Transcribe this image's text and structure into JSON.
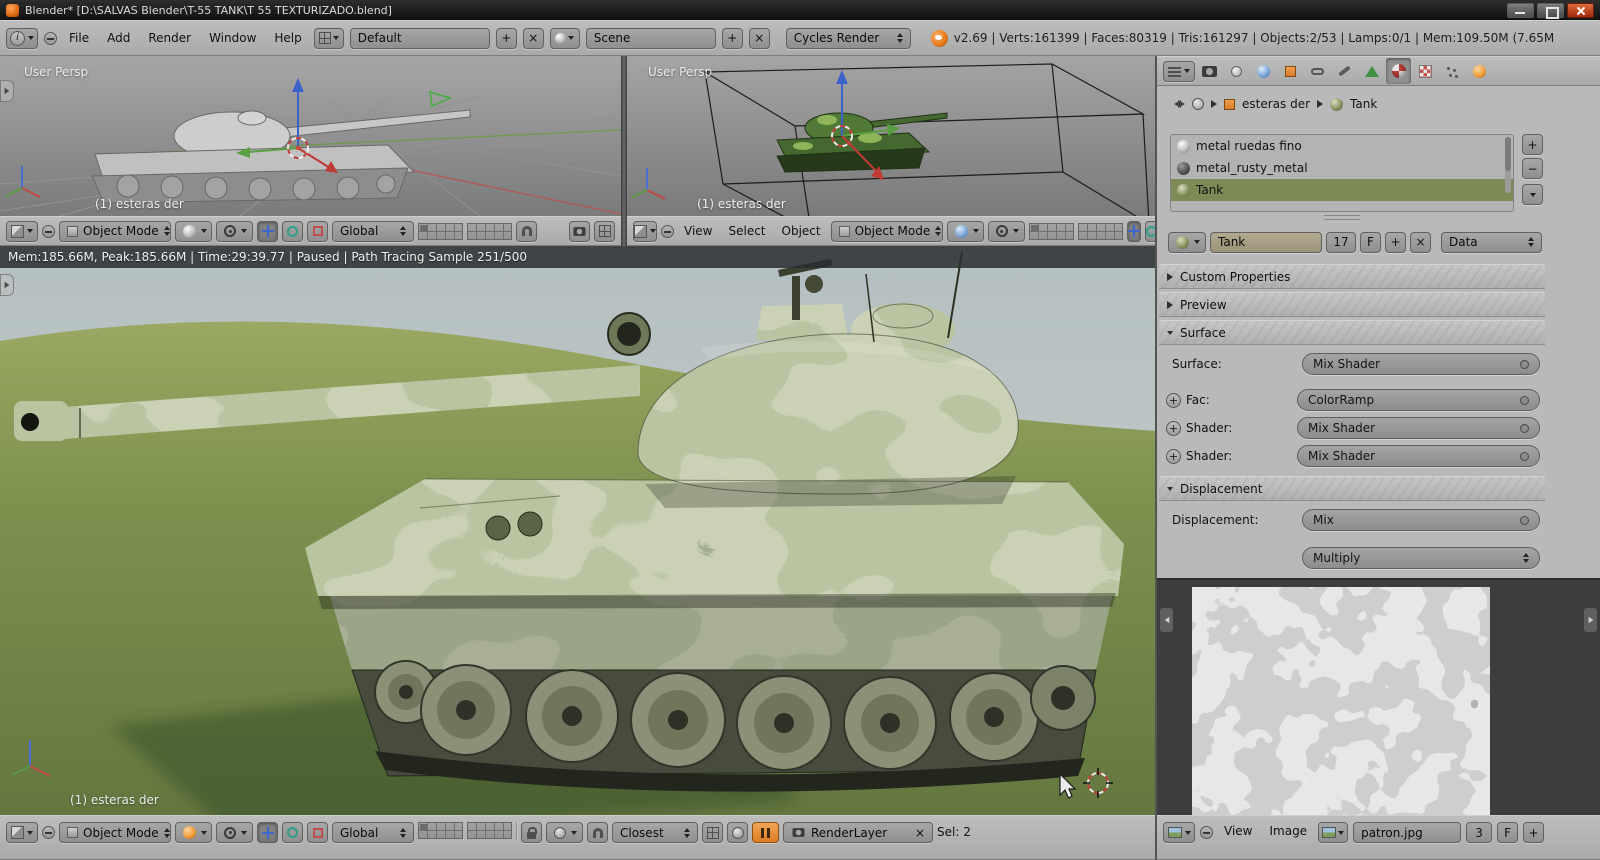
{
  "window": {
    "title": "Blender* [D:\\SALVAS Blender\\T-55 TANK\\T 55 TEXTURIZADO.blend]"
  },
  "info_bar": {
    "menus": [
      "File",
      "Add",
      "Render",
      "Window",
      "Help"
    ],
    "layout_name": "Default",
    "scene_name": "Scene",
    "engine": "Cycles Render",
    "stats": "v2.69 | Verts:161399 | Faces:80319 | Tris:161297 | Objects:2/53 | Lamps:0/1 | Mem:109.50M (7.65M"
  },
  "viewport_left": {
    "view_label": "User Persp",
    "object_label": "(1) esteras der",
    "mode": "Object Mode",
    "orientation": "Global"
  },
  "viewport_mid": {
    "view_label": "User Persp",
    "object_label": "(1) esteras der",
    "menus": [
      "View",
      "Select",
      "Object"
    ],
    "mode": "Object Mode"
  },
  "render_viewport": {
    "status": "Mem:185.66M, Peak:185.66M | Time:29:39.77 | Paused | Path Tracing Sample 251/500",
    "object_label": "(1) esteras der",
    "mode": "Object Mode",
    "orientation": "Global",
    "snap_target": "Closest",
    "render_layer": "RenderLayer",
    "selection": "Sel: 2"
  },
  "properties": {
    "context_object": "esteras der",
    "context_material": "Tank",
    "material_slots": [
      "metal ruedas fino",
      "metal_rusty_metal",
      "Tank"
    ],
    "name_field": "Tank",
    "users_count": "17",
    "fake_user": "F",
    "link_mode": "Data",
    "panel_custom_properties": "Custom Properties",
    "panel_preview": "Preview",
    "panel_surface": "Surface",
    "panel_displacement": "Displacement",
    "surface_rows": [
      {
        "label": "Surface:",
        "value": "Mix Shader"
      },
      {
        "label": "Fac:",
        "value": "ColorRamp"
      },
      {
        "label": "Shader:",
        "value": "Mix Shader"
      },
      {
        "label": "Shader:",
        "value": "Mix Shader"
      }
    ],
    "displacement_label": "Displacement:",
    "displacement_value": "Mix",
    "blend_mode": "Multiply"
  },
  "image_editor": {
    "menus": [
      "View",
      "Image"
    ],
    "image_name": "patron.jpg",
    "users_count": "3",
    "fake_user": "F"
  },
  "glyphs": {
    "add": "+",
    "remove": "−",
    "close": "×"
  },
  "colors": {
    "selected_slot": "#7d8a55",
    "pause_orange": "#e8923a",
    "header_gray": "#b4b4b4",
    "selected_outline": "#e07a2a"
  }
}
